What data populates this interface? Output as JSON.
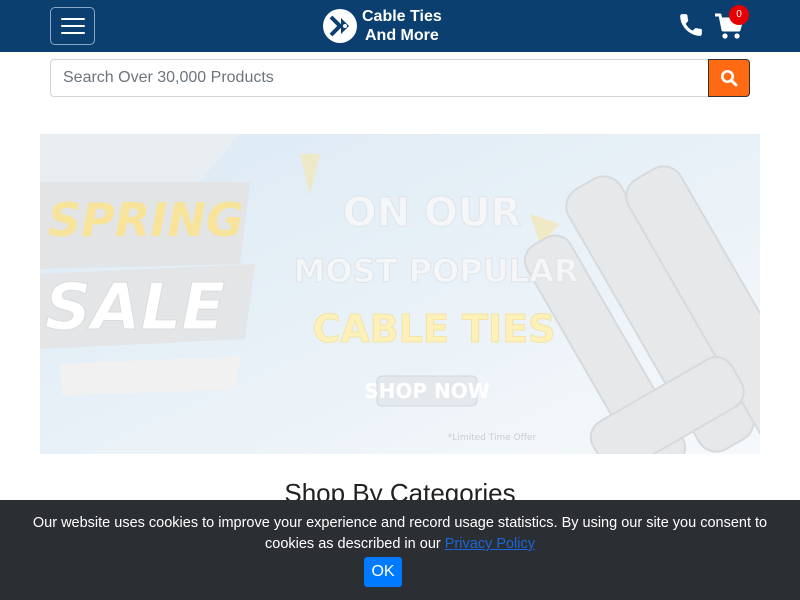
{
  "header": {
    "brand_line1": "Cable Ties",
    "brand_line2": "And More",
    "cart_count": "0",
    "icons": [
      "menu-icon",
      "logo-icon",
      "phone-icon",
      "cart-icon",
      "search-icon"
    ],
    "colors": {
      "header_bg": "#0a3f6f",
      "search_button": "#ff6a13",
      "badge": "#e60000"
    }
  },
  "search": {
    "placeholder": "Search Over 30,000 Products",
    "value": ""
  },
  "banner": {
    "word1": "SPRING",
    "word2": "SALE",
    "line1": "ON OUR",
    "line2": "MOST POPULAR",
    "line3": "CABLE TIES",
    "cta": "SHOP NOW",
    "note": "*Limited Time Offer"
  },
  "main": {
    "categories_title": "Shop By Categories"
  },
  "cookie": {
    "text": "Our website uses cookies to improve your experience and record usage statistics. By using our site you consent to cookies as described in our",
    "link": "Privacy Policy",
    "ok_label": "OK",
    "colors": {
      "bar_bg": "#2b2f33",
      "ok_button": "#007bff"
    }
  }
}
